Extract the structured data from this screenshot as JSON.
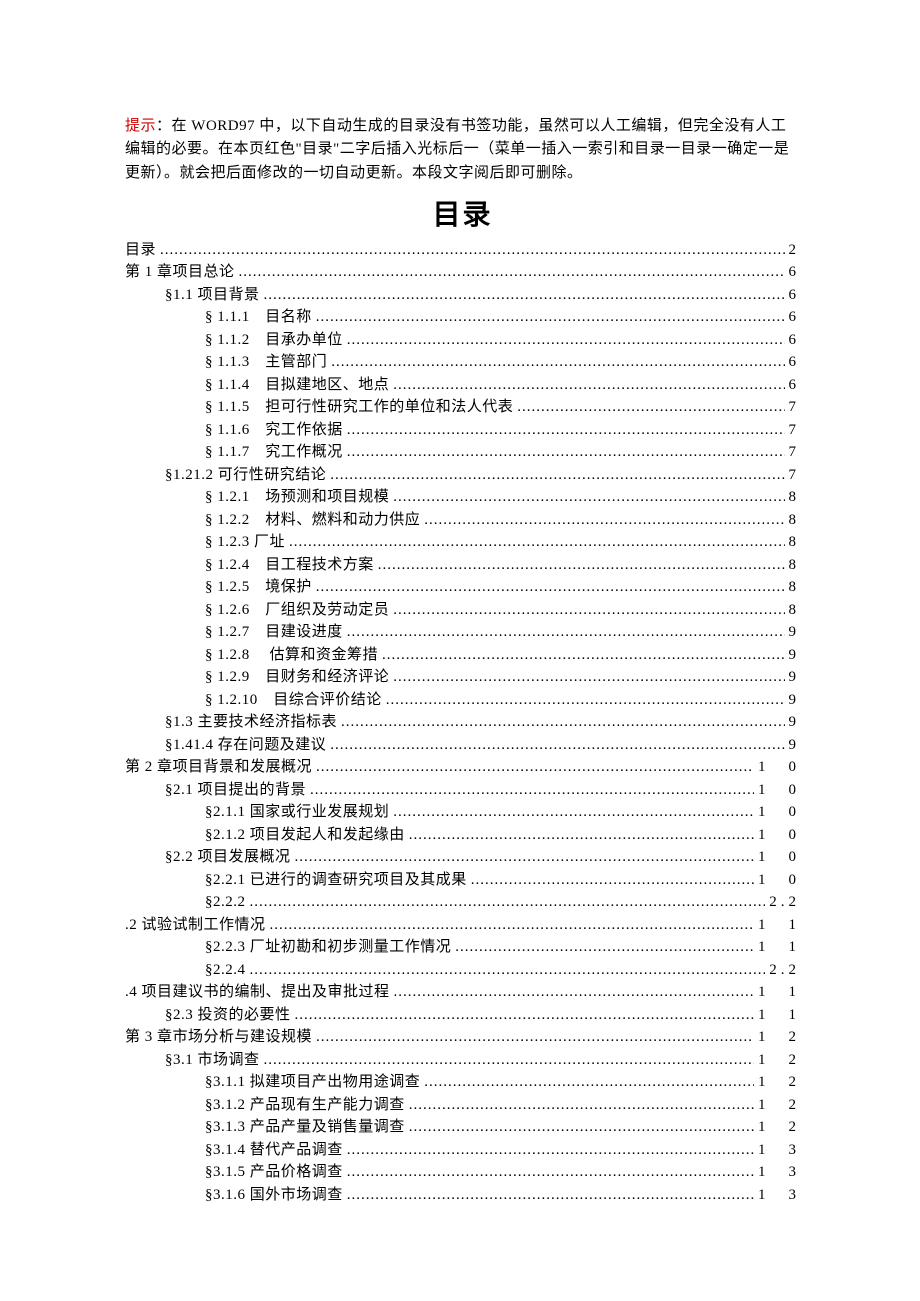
{
  "hint": {
    "label": "提示",
    "colon": "：",
    "text": "在 WORD97 中，以下自动生成的目录没有书签功能，虽然可以人工编辑，但完全没有人工编辑的必要。在本页红色\"目录\"二字后插入光标后一（菜单一插入一索引和目录一目录一确定一是更新）。就会把后面修改的一切自动更新。本段文字阅后即可删除。"
  },
  "title": "目录",
  "toc": [
    {
      "level": 1,
      "label": "目录",
      "page": "2"
    },
    {
      "level": 1,
      "label": "第 1 章项目总论",
      "page": "6"
    },
    {
      "level": 2,
      "label": "§1.1 项目背景",
      "page": "6"
    },
    {
      "level": 3,
      "label": "§ 1.1.1　目名称",
      "page": "6"
    },
    {
      "level": 3,
      "label": "§ 1.1.2　目承办单位",
      "page": "6"
    },
    {
      "level": 3,
      "label": "§ 1.1.3　主管部门",
      "page": "6"
    },
    {
      "level": 3,
      "label": "§ 1.1.4　目拟建地区、地点",
      "page": "6"
    },
    {
      "level": 3,
      "label": "§ 1.1.5　担可行性研究工作的单位和法人代表",
      "page": "7"
    },
    {
      "level": 3,
      "label": "§ 1.1.6　究工作依据",
      "page": "7"
    },
    {
      "level": 3,
      "label": "§ 1.1.7　究工作概况",
      "page": "7"
    },
    {
      "level": 2,
      "label": "§1.21.2 可行性研究结论",
      "page": "7"
    },
    {
      "level": 3,
      "label": "§ 1.2.1　场预测和项目规模",
      "page": "8"
    },
    {
      "level": 3,
      "label": "§ 1.2.2　材料、燃料和动力供应",
      "page": "8"
    },
    {
      "level": 3,
      "label": "§ 1.2.3 厂址",
      "page": "8"
    },
    {
      "level": 3,
      "label": "§ 1.2.4　目工程技术方案",
      "page": "8"
    },
    {
      "level": 3,
      "label": "§ 1.2.5　境保护",
      "page": "8"
    },
    {
      "level": 3,
      "label": "§ 1.2.6　厂组织及劳动定员",
      "page": "8"
    },
    {
      "level": 3,
      "label": "§ 1.2.7　目建设进度",
      "page": "9"
    },
    {
      "level": 3,
      "label": "§ 1.2.8　 估算和资金筹措",
      "page": "9"
    },
    {
      "level": 3,
      "label": "§ 1.2.9　目财务和经济评论",
      "page": "9"
    },
    {
      "level": 3,
      "label": "§ 1.2.10　目综合评价结论",
      "page": "9"
    },
    {
      "level": 2,
      "label": "§1.3 主要技术经济指标表",
      "page": "9"
    },
    {
      "level": 2,
      "label": "§1.41.4 存在问题及建议",
      "page": "9"
    },
    {
      "level": 1,
      "label": "第 2 章项目背景和发展概况",
      "page": "1　0"
    },
    {
      "level": 2,
      "label": "§2.1 项目提出的背景",
      "page": "1　0"
    },
    {
      "level": 3,
      "label": "§2.1.1 国家或行业发展规划",
      "page": "1　0"
    },
    {
      "level": 3,
      "label": "§2.1.2 项目发起人和发起缘由",
      "page": "1　0"
    },
    {
      "level": 2,
      "label": "§2.2 项目发展概况",
      "page": "1　0"
    },
    {
      "level": 3,
      "label": "§2.2.1 已进行的调查研究项目及其成果",
      "page": "1　0"
    },
    {
      "level": 3,
      "label": "§2.2.2",
      "page": "2.2"
    },
    {
      "level": 1,
      "label": ".2 试验试制工作情况",
      "page": "1　1"
    },
    {
      "level": 3,
      "label": "§2.2.3 厂址初勘和初步测量工作情况",
      "page": "1　1"
    },
    {
      "level": 3,
      "label": "§2.2.4",
      "page": "2.2"
    },
    {
      "level": 1,
      "label": ".4 项目建议书的编制、提出及审批过程",
      "page": "1　1"
    },
    {
      "level": 2,
      "label": "§2.3 投资的必要性",
      "page": "1　1"
    },
    {
      "level": 1,
      "label": "第 3 章市场分析与建设规模",
      "page": "1　2"
    },
    {
      "level": 2,
      "label": "§3.1 市场调查",
      "page": "1　2"
    },
    {
      "level": 3,
      "label": "§3.1.1 拟建项目产出物用途调查",
      "page": "1　2"
    },
    {
      "level": 3,
      "label": "§3.1.2 产品现有生产能力调查",
      "page": "1　2"
    },
    {
      "level": 3,
      "label": "§3.1.3 产品产量及销售量调查",
      "page": "1　2"
    },
    {
      "level": 3,
      "label": "§3.1.4 替代产品调查",
      "page": "1　3"
    },
    {
      "level": 3,
      "label": "§3.1.5 产品价格调查",
      "page": "1　3"
    },
    {
      "level": 3,
      "label": "§3.1.6 国外市场调查",
      "page": "1　3"
    }
  ]
}
